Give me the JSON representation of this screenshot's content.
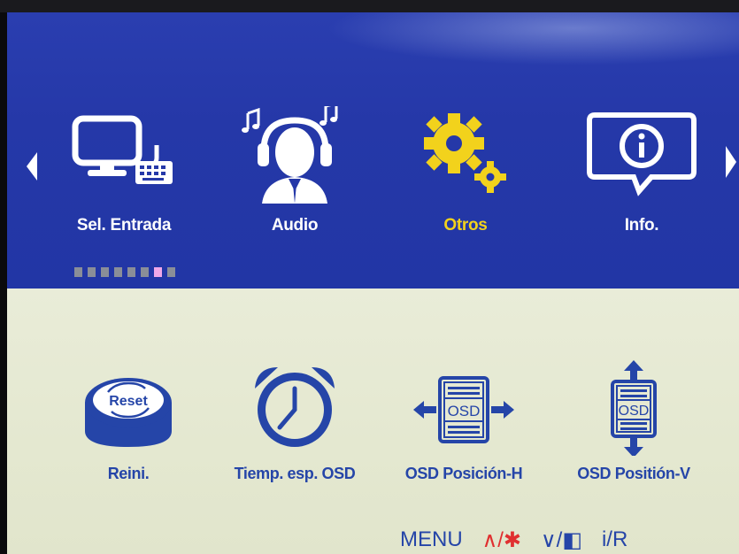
{
  "colors": {
    "menu_bg": "#2538a8",
    "panel_bg": "#e6e9d2",
    "active": "#f2d21c",
    "inactive_label": "#ffffff",
    "sub_label": "#2545a8",
    "warning": "#e03030"
  },
  "top_menu": [
    {
      "label": "Sel. Entrada",
      "icon": "monitor-keyboard-icon",
      "selected": false
    },
    {
      "label": "Audio",
      "icon": "headphones-person-icon",
      "selected": false
    },
    {
      "label": "Otros",
      "icon": "gears-icon",
      "selected": true
    },
    {
      "label": "Info.",
      "icon": "info-icon",
      "selected": false
    }
  ],
  "page_indicator": {
    "count": 8,
    "active_index": 6
  },
  "sub_menu": [
    {
      "label": "Reini.",
      "icon": "reset-button-icon"
    },
    {
      "label": "Tiemp. esp. OSD",
      "icon": "alarm-clock-icon"
    },
    {
      "label": "OSD Posición-H",
      "icon": "osd-horizontal-icon",
      "icon_text": "OSD"
    },
    {
      "label": "OSD Positión-V",
      "icon": "osd-vertical-icon",
      "icon_text": "OSD"
    }
  ],
  "reset_icon_text": "Reset",
  "footer": {
    "menu": "MENU",
    "up": "∧/✱",
    "down": "∨/◧",
    "input": "i/R"
  }
}
